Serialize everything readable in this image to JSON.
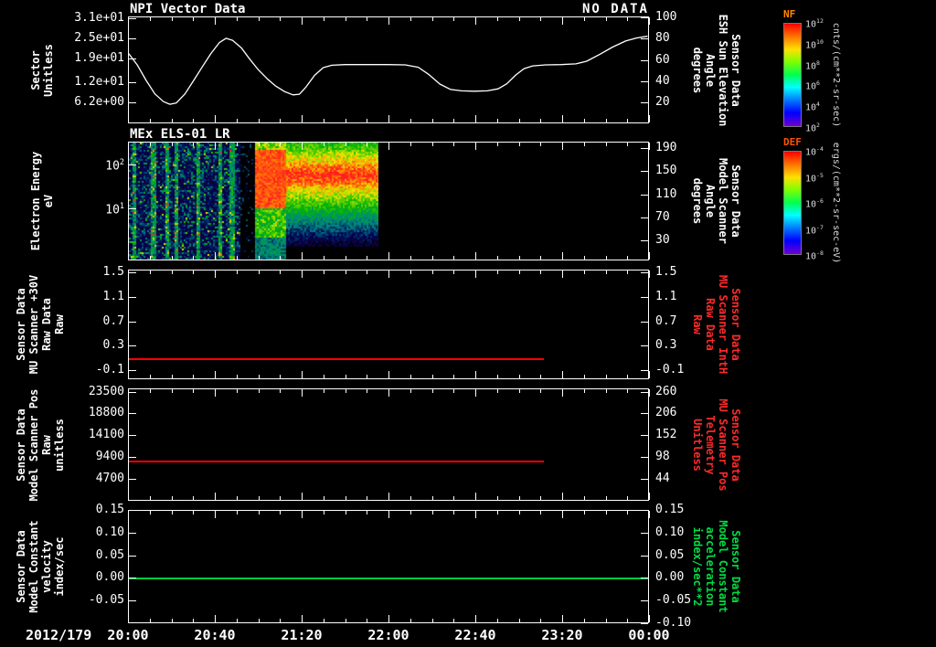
{
  "colors": {
    "background": "#000000",
    "axis": "#ffffff",
    "red_trace": "#ff0000",
    "green_trace": "#00cc44",
    "red_label": "#ff2a2a",
    "green_label": "#00dd44",
    "nf_title": "#ff8800",
    "def_title": "#ff5500"
  },
  "header": {
    "panel1_title": "NPI Vector Data",
    "no_data": "NO DATA",
    "panel2_title": "MEx ELS-01 LR"
  },
  "xaxis": {
    "date_label": "2012/179",
    "ticks": [
      "20:00",
      "20:40",
      "21:20",
      "22:00",
      "22:40",
      "23:20",
      "00:00"
    ]
  },
  "panels": [
    {
      "name": "npi-vector-data",
      "left_label_lines": [
        "Sector",
        "Unitless"
      ],
      "left_ticks": [
        {
          "label": "3.1e+01",
          "frac": 0.016
        },
        {
          "label": "2.5e+01",
          "frac": 0.206
        },
        {
          "label": "1.9e+01",
          "frac": 0.397
        },
        {
          "label": "1.2e+01",
          "frac": 0.619
        },
        {
          "label": "6.2e+00",
          "frac": 0.803
        }
      ],
      "right_label_lines": [
        "Sensor Data",
        "ESH Sun Elevation",
        "Angle",
        "degrees"
      ],
      "right_label_color": "#ffffff",
      "right_ticks": [
        {
          "label": "100",
          "frac": 0.01
        },
        {
          "label": "80",
          "frac": 0.208
        },
        {
          "label": "60",
          "frac": 0.406
        },
        {
          "label": "40",
          "frac": 0.604
        },
        {
          "label": "20",
          "frac": 0.802
        }
      ]
    },
    {
      "name": "els-spectrogram",
      "left_label_lines": [
        "Electron Energy",
        "eV"
      ],
      "left_ticks": [
        {
          "label": "10^2",
          "frac": 0.19
        },
        {
          "label": "10^1",
          "frac": 0.56
        }
      ],
      "right_label_lines": [
        "Sensor Data",
        "Model Scanner",
        "Angle",
        "degrees"
      ],
      "right_label_color": "#ffffff",
      "right_ticks": [
        {
          "label": "190",
          "frac": 0.054
        },
        {
          "label": "150",
          "frac": 0.248
        },
        {
          "label": "110",
          "frac": 0.443
        },
        {
          "label": "70",
          "frac": 0.637
        },
        {
          "label": "30",
          "frac": 0.832
        }
      ]
    },
    {
      "name": "mu-scanner-30v",
      "left_label_lines": [
        "Sensor Data",
        "MU Scanner +30V",
        "Raw Data",
        "Raw"
      ],
      "left_ticks": [
        {
          "label": "1.5",
          "frac": 0.028
        },
        {
          "label": "1.1",
          "frac": 0.25
        },
        {
          "label": "0.7",
          "frac": 0.472
        },
        {
          "label": "0.3",
          "frac": 0.694
        },
        {
          "label": "-0.1",
          "frac": 0.917
        }
      ],
      "right_label_lines": [
        "Sensor Data",
        "MU Scanner IntH",
        "Raw Data",
        "Raw"
      ],
      "right_label_color": "#ff2a2a",
      "right_ticks": [
        {
          "label": "1.5",
          "frac": 0.028
        },
        {
          "label": "1.1",
          "frac": 0.25
        },
        {
          "label": "0.7",
          "frac": 0.472
        },
        {
          "label": "0.3",
          "frac": 0.694
        },
        {
          "label": "-0.1",
          "frac": 0.917
        }
      ]
    },
    {
      "name": "model-scanner-pos",
      "left_label_lines": [
        "Sensor Data",
        "Model Scanner Pos",
        "Raw",
        "unitless"
      ],
      "left_ticks": [
        {
          "label": "23500",
          "frac": 0.029
        },
        {
          "label": "18800",
          "frac": 0.223
        },
        {
          "label": "14100",
          "frac": 0.417
        },
        {
          "label": "9400",
          "frac": 0.612
        },
        {
          "label": "4700",
          "frac": 0.806
        }
      ],
      "right_label_lines": [
        "Sensor Data",
        "MU Scanner Pos",
        "Telemetry",
        "Unitless"
      ],
      "right_label_color": "#ff2a2a",
      "right_ticks": [
        {
          "label": "260",
          "frac": 0.029
        },
        {
          "label": "206",
          "frac": 0.223
        },
        {
          "label": "152",
          "frac": 0.417
        },
        {
          "label": "98",
          "frac": 0.612
        },
        {
          "label": "44",
          "frac": 0.806
        }
      ]
    },
    {
      "name": "model-constant-velocity",
      "left_label_lines": [
        "Sensor Data",
        "Model Constant",
        "velocity",
        "index/sec"
      ],
      "left_ticks": [
        {
          "label": "0.15",
          "frac": 0.0
        },
        {
          "label": "0.10",
          "frac": 0.2
        },
        {
          "label": "0.05",
          "frac": 0.4
        },
        {
          "label": "0.00",
          "frac": 0.6
        },
        {
          "label": "-0.05",
          "frac": 0.8
        }
      ],
      "right_label_lines": [
        "Sensor Data",
        "Model Constant",
        "acceleration",
        "index/sec**2"
      ],
      "right_label_color": "#00dd44",
      "right_ticks": [
        {
          "label": "0.15",
          "frac": 0.0
        },
        {
          "label": "0.10",
          "frac": 0.2
        },
        {
          "label": "0.05",
          "frac": 0.4
        },
        {
          "label": "0.00",
          "frac": 0.6
        },
        {
          "label": "-0.05",
          "frac": 0.8
        },
        {
          "label": "-0.10",
          "frac": 1.0
        }
      ]
    }
  ],
  "colorbars": [
    {
      "name": "NF",
      "label_color": "#ff8800",
      "unit_label": "cnts/(cm**2-sr-sec)",
      "ticks": [
        "10^12",
        "10^10",
        "10^8",
        "10^6",
        "10^4",
        "10^2"
      ]
    },
    {
      "name": "DEF",
      "label_color": "#ff5500",
      "unit_label": "ergs/(cm**2-sr-sec-eV)",
      "ticks": [
        "10^-4",
        "10^-5",
        "10^-6",
        "10^-7",
        "10^-8"
      ]
    }
  ],
  "chart_data": [
    {
      "type": "line",
      "title": "NPI Vector Data",
      "status": "NO DATA",
      "ylabel": "Sector Unitless",
      "y2label": "Sensor Data ESH Sun Elevation Angle degrees",
      "yrange": [
        0,
        31.5
      ],
      "x_unit": "minutes after 2012/179 20:00",
      "x": [
        0,
        4,
        8,
        12,
        16,
        19,
        22,
        26,
        30,
        34,
        38,
        42,
        45,
        48,
        52,
        56,
        60,
        64,
        68,
        72,
        76,
        79,
        82,
        86,
        90,
        94,
        100,
        110,
        120,
        128,
        134,
        139,
        144,
        149,
        154,
        160,
        166,
        171,
        175,
        179,
        183,
        187,
        193,
        200,
        207,
        212,
        218,
        224,
        230,
        235,
        240
      ],
      "values": [
        20.4,
        17,
        12.5,
        8.5,
        6.2,
        5.4,
        5.8,
        8.5,
        12.5,
        16.5,
        20.5,
        23.8,
        25,
        24.4,
        22.2,
        18.8,
        15.6,
        13,
        10.8,
        9.2,
        8.2,
        8.4,
        10.5,
        14,
        16.3,
        17,
        17.2,
        17.2,
        17.2,
        17.1,
        16.4,
        14.2,
        11.4,
        9.8,
        9.4,
        9.3,
        9.4,
        10,
        11.5,
        14,
        16,
        16.8,
        17.1,
        17.2,
        17.4,
        18.2,
        20.2,
        22.4,
        24.2,
        25.1,
        25.6
      ],
      "color": "#ffffff"
    },
    {
      "type": "heatmap",
      "title": "MEx ELS-01 LR",
      "ylabel": "Electron Energy eV",
      "yscale": "log",
      "yrange_ev": [
        0.7,
        320
      ],
      "x_unit": "minutes after 2012/179 20:00",
      "x_coverage_frac": [
        0.0,
        0.48
      ],
      "regions": [
        {
          "x_frac": [
            0.0,
            0.44
          ],
          "kind": "blue-speckle-background"
        },
        {
          "x_frac": [
            0.44,
            0.5
          ],
          "kind": "data-gap-dark"
        },
        {
          "x_frac": [
            0.5,
            0.625
          ],
          "kind": "intense-red-burst-top-half"
        },
        {
          "x_frac": [
            0.625,
            1.0
          ],
          "kind": "banded-rainbow-flux-peak-high-energy"
        }
      ],
      "bright_column_fracs": [
        0.02,
        0.095,
        0.15,
        0.185,
        0.275,
        0.36,
        0.41
      ]
    },
    {
      "type": "line",
      "title": "Sensor Data MU Scanner +30V Raw Data Raw",
      "yrange": [
        -0.25,
        1.55
      ],
      "constant_value": 0.1,
      "x_extent_frac": [
        0,
        0.8
      ],
      "color": "#ff0000"
    },
    {
      "type": "line",
      "title": "Sensor Data Model Scanner Pos Raw unitless",
      "yrange": [
        0,
        24200
      ],
      "constant_value": 8600,
      "x_extent_frac": [
        0,
        0.8
      ],
      "color": "#ff0000"
    },
    {
      "type": "line",
      "title": "Sensor Data Model Constant velocity index/sec",
      "yrange": [
        -0.1,
        0.15
      ],
      "constant_value": 0.0,
      "x_extent_frac": [
        0,
        1.0
      ],
      "color": "#00cc44"
    }
  ]
}
